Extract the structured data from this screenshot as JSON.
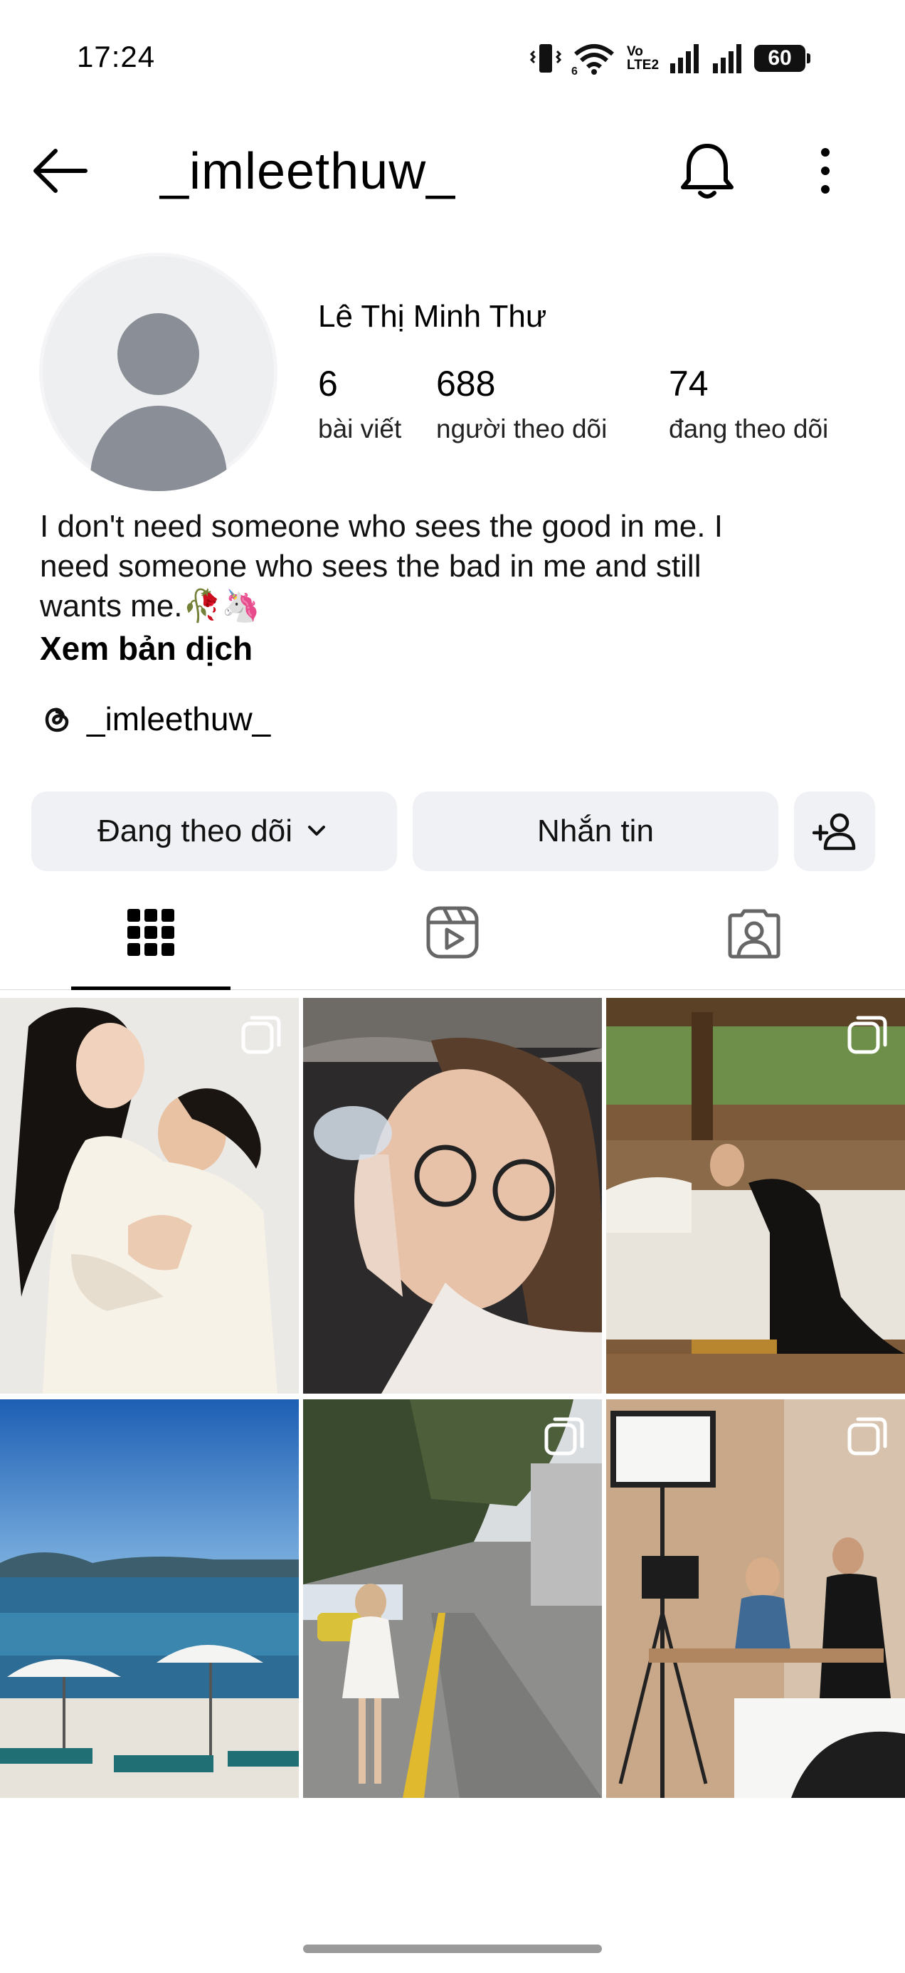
{
  "status_bar": {
    "time": "17:24",
    "volte_label_top": "Vo",
    "volte_label_bottom": "LTE2",
    "battery": "60"
  },
  "header": {
    "username": "_imleethuw_",
    "icons": [
      "back-arrow-icon",
      "bell-icon",
      "more-vertical-icon"
    ]
  },
  "profile": {
    "full_name": "Lê Thị Minh Thư",
    "stats": [
      {
        "value": "6",
        "label": "bài viết"
      },
      {
        "value": "688",
        "label": "người theo dõi"
      },
      {
        "value": "74",
        "label": "đang theo dõi"
      }
    ],
    "bio_line1": "I don't need someone who sees the good in me. I",
    "bio_line2": "need someone who sees the bad in me and still",
    "bio_line3": "wants me.🥀🦄",
    "translate_label": "Xem bản dịch",
    "threads_handle": "_imleethuw_"
  },
  "actions": {
    "following_label": "Đang theo dõi",
    "message_label": "Nhắn tin",
    "suggest_icon": "add-person-icon"
  },
  "tabs": [
    {
      "name": "posts",
      "icon": "grid-icon",
      "active": true
    },
    {
      "name": "reels",
      "icon": "reels-icon",
      "active": false
    },
    {
      "name": "tagged",
      "icon": "tagged-icon",
      "active": false
    }
  ],
  "grid_posts": [
    {
      "kind": "photo-couple-hug",
      "multi": true
    },
    {
      "kind": "photo-underwater-glasses",
      "multi": false
    },
    {
      "kind": "photo-resort-lounge",
      "multi": true
    },
    {
      "kind": "photo-beach-umbrellas",
      "multi": false
    },
    {
      "kind": "photo-street-white-dress",
      "multi": true
    },
    {
      "kind": "photo-studio-cameras",
      "multi": true
    }
  ],
  "colors": {
    "button_bg": "#eff1f4",
    "avatar_placeholder": "#8a8e96",
    "divider": "#dbdbdb"
  }
}
